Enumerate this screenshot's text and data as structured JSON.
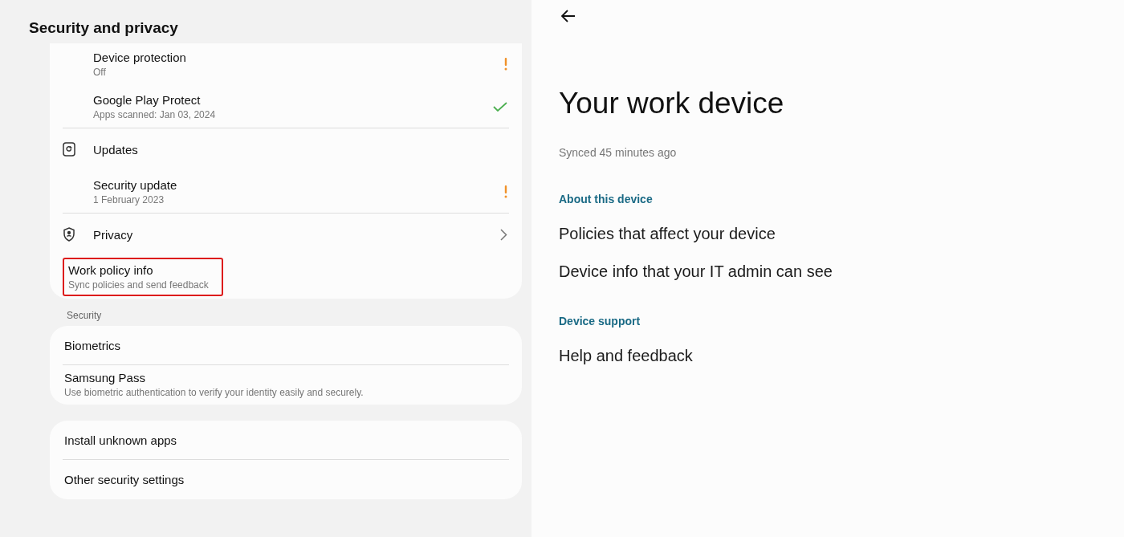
{
  "left": {
    "title": "Security and privacy",
    "groups": [
      {
        "items": [
          {
            "kind": "sub",
            "title": "Device protection",
            "subtitle": "Off",
            "warning": true,
            "verified": false,
            "divider": false,
            "highlighted": false
          },
          {
            "kind": "sub",
            "title": "Google Play Protect",
            "subtitle": "Apps scanned: Jan 03, 2024",
            "warning": false,
            "verified": true,
            "divider": true,
            "highlighted": false
          },
          {
            "kind": "update-header",
            "title": "Updates",
            "warning": false,
            "verified": false,
            "divider": false,
            "highlighted": false
          },
          {
            "kind": "sub",
            "title": "Security update",
            "subtitle": "1 February 2023",
            "warning": true,
            "verified": false,
            "divider": true,
            "highlighted": false
          },
          {
            "kind": "privacy-link",
            "title": "Privacy",
            "warning": false,
            "verified": false,
            "divider": false,
            "highlighted": false
          },
          {
            "kind": "plain",
            "title": "Work policy info",
            "subtitle": "Sync policies and send feedback",
            "warning": false,
            "verified": false,
            "divider": false,
            "highlighted": true
          }
        ]
      },
      {
        "label": "Security",
        "items": [
          {
            "kind": "plain",
            "title": "Biometrics",
            "warning": false,
            "verified": false,
            "divider": true,
            "highlighted": false
          },
          {
            "kind": "plain",
            "title": "Samsung Pass",
            "subtitle": "Use biometric authentication to verify your identity easily and securely.",
            "warning": false,
            "verified": false,
            "divider": false,
            "highlighted": false
          }
        ]
      },
      {
        "items": [
          {
            "kind": "plain",
            "title": "Install unknown apps",
            "warning": false,
            "verified": false,
            "divider": true,
            "highlighted": false
          },
          {
            "kind": "plain",
            "title": "Other security settings",
            "warning": false,
            "verified": false,
            "divider": false,
            "highlighted": false
          }
        ]
      }
    ]
  },
  "right": {
    "title": "Your work device",
    "synced": "Synced 45 minutes ago",
    "sections": [
      {
        "heading": "About this device",
        "items": [
          "Policies that affect your device",
          "Device info that your IT admin can see"
        ]
      },
      {
        "heading": "Device support",
        "items": [
          "Help and feedback"
        ]
      }
    ]
  }
}
